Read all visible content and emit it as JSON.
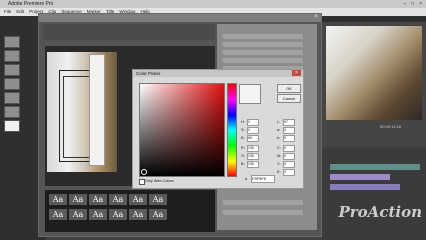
{
  "app": {
    "title": "Adobe Premiere Pro"
  },
  "menu": [
    "File",
    "Edit",
    "Project",
    "Clip",
    "Sequence",
    "Marker",
    "Title",
    "Window",
    "Help"
  ],
  "color_picker": {
    "title": "Color Picker",
    "ok": "OK",
    "cancel": "Cancel",
    "web_only": "Only Web Colors",
    "hex_label": "#",
    "hex": "F5F5F5",
    "fields": [
      {
        "label": "H:",
        "value": "0"
      },
      {
        "label": "S:",
        "value": "0"
      },
      {
        "label": "B:",
        "value": "96"
      },
      {
        "label": "R:",
        "value": "245"
      },
      {
        "label": "G:",
        "value": "245"
      },
      {
        "label": "B:",
        "value": "245"
      }
    ],
    "fields_right": [
      {
        "label": "L:",
        "value": "97"
      },
      {
        "label": "a:",
        "value": "0"
      },
      {
        "label": "b:",
        "value": "0"
      },
      {
        "label": "C:",
        "value": "0"
      },
      {
        "label": "M:",
        "value": "0"
      },
      {
        "label": "Y:",
        "value": "0"
      },
      {
        "label": "K:",
        "value": "4"
      }
    ]
  },
  "styles": [
    "Aa",
    "Aa",
    "Aa",
    "Aa",
    "Aa",
    "Aa",
    "Aa",
    "Aa",
    "Aa",
    "Aa",
    "Aa",
    "Aa"
  ],
  "monitor": {
    "timecode": "00:00:12:16"
  },
  "watermark": "ProAction"
}
